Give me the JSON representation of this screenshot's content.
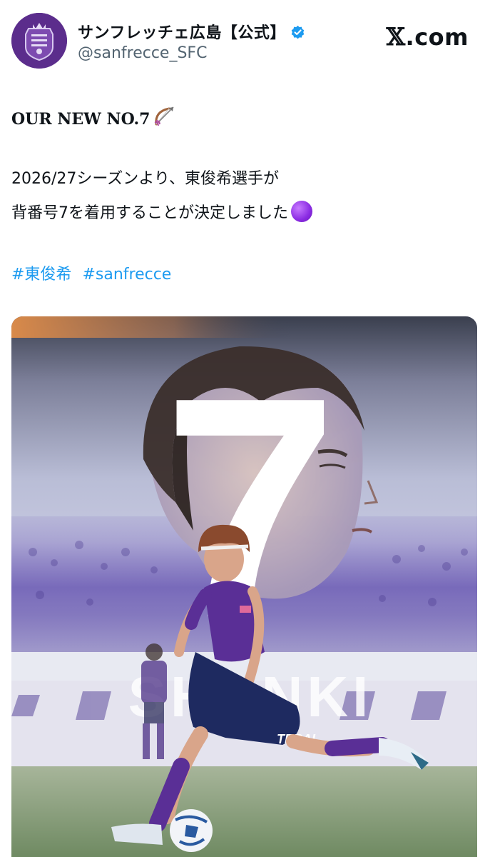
{
  "account": {
    "display_name": "サンフレッチェ広島【公式】",
    "handle": "@sanfrecce_SFC",
    "verified_icon": "verified-badge-icon",
    "avatar_icon": "club-crest-icon"
  },
  "brand": {
    "x_glyph": "𝕏",
    "suffix": ".com"
  },
  "post": {
    "headline": "OUR NEW NO.7",
    "line1": "2026/27シーズンより、東俊希選手が",
    "line2": "背番号7を着用することが決定しました",
    "hashtags": [
      "#東俊希",
      "#sanfrecce"
    ]
  },
  "media": {
    "big_number": "7",
    "name_text": "SHUNKI",
    "sponsor_text": "TERAL"
  },
  "colors": {
    "link": "#1d9bf0",
    "club_purple": "#5b2d8c",
    "handle_gray": "#536471"
  }
}
